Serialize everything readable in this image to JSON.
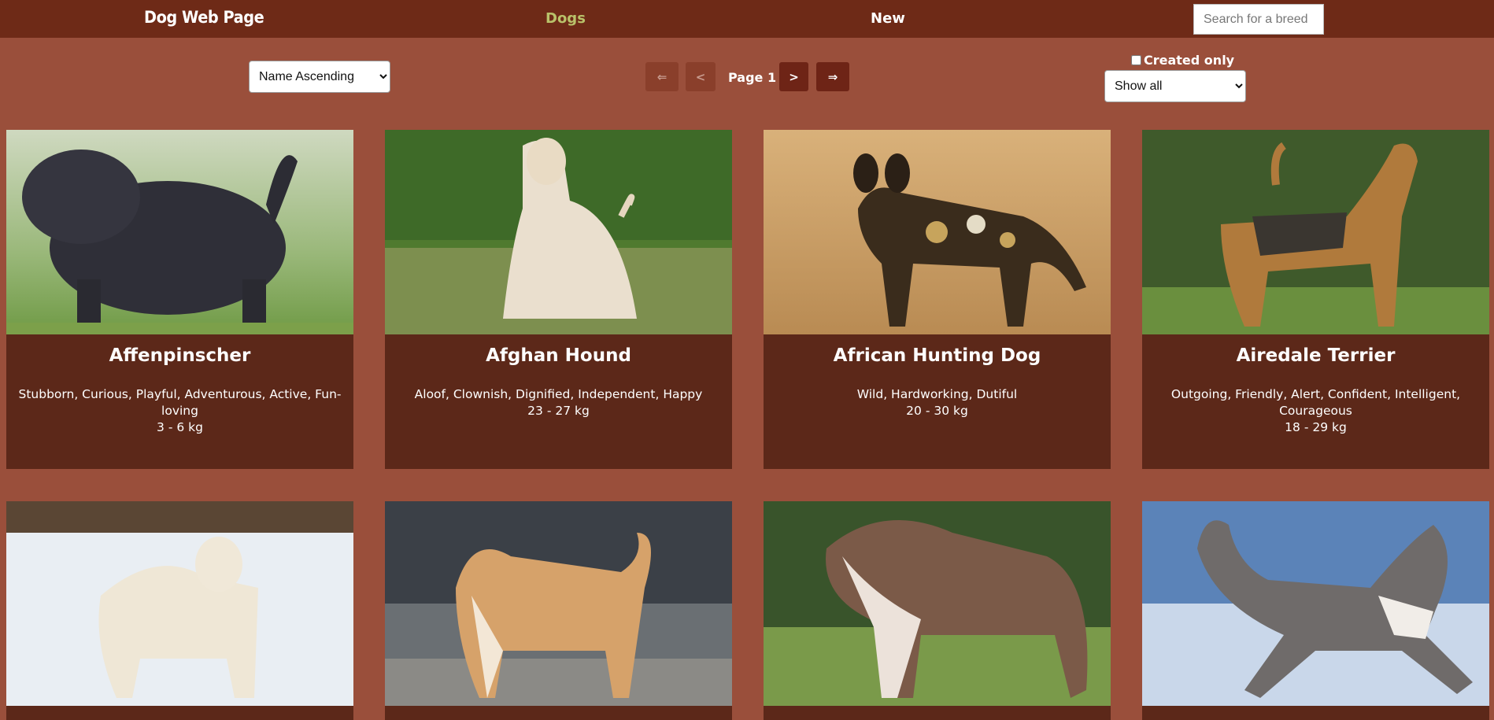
{
  "header": {
    "brand": "Dog Web Page",
    "nav": {
      "dogs": "Dogs",
      "new": "New"
    },
    "search_placeholder": "Search for a breed"
  },
  "controls": {
    "sort_selected": "Name Ascending",
    "filter_selected": "Show all",
    "created_only_label": "Created only",
    "pagination": {
      "first": "⇐",
      "prev": "<",
      "page_label": "Page 1",
      "next": ">",
      "last": "⇒"
    }
  },
  "cards": [
    {
      "name": "Affenpinscher",
      "temperament": "Stubborn, Curious, Playful, Adventurous, Active, Fun-loving",
      "weight": "3 - 6 kg"
    },
    {
      "name": "Afghan Hound",
      "temperament": "Aloof, Clownish, Dignified, Independent, Happy",
      "weight": "23 - 27 kg"
    },
    {
      "name": "African Hunting Dog",
      "temperament": "Wild, Hardworking, Dutiful",
      "weight": "20 - 30 kg"
    },
    {
      "name": "Airedale Terrier",
      "temperament": "Outgoing, Friendly, Alert, Confident, Intelligent, Courageous",
      "weight": "18 - 29 kg"
    }
  ],
  "colors": {
    "page_bg": "#9a4f3b",
    "topbar_bg": "#6e2a17",
    "card_bg": "#5c2819",
    "nav_active": "#b9c26a"
  }
}
